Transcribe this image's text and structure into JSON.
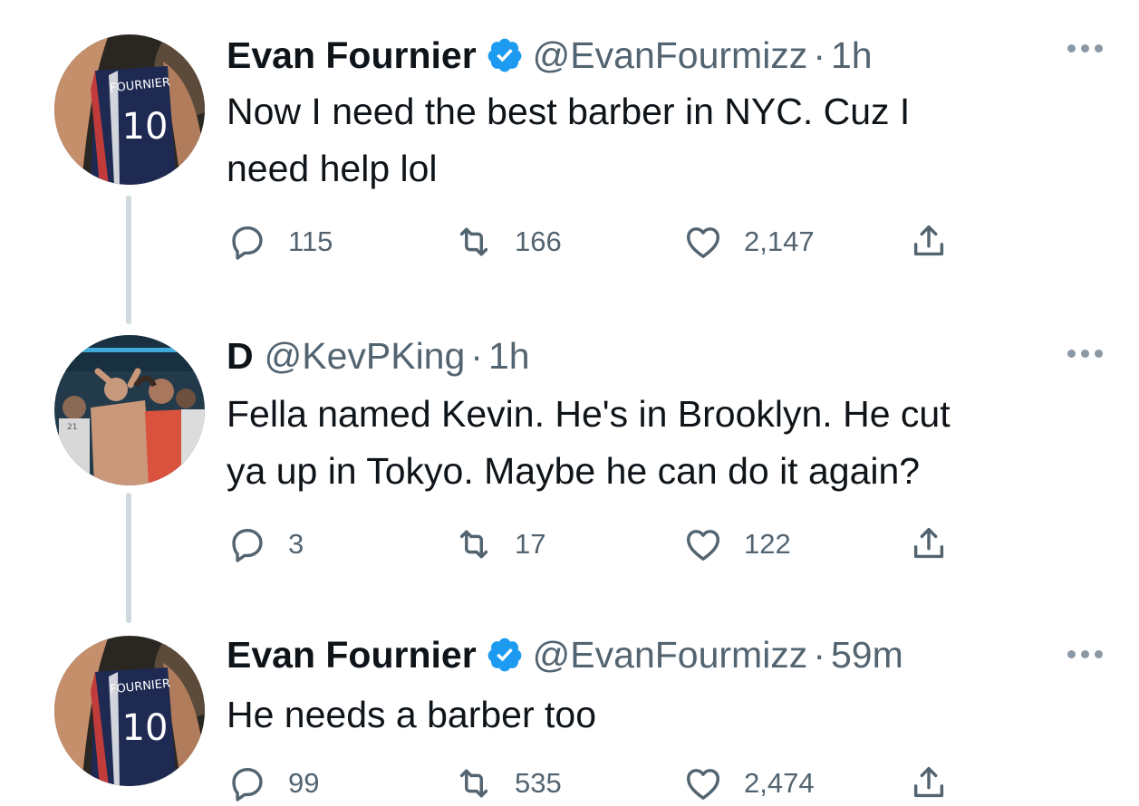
{
  "tweets": [
    {
      "name": "Evan Fournier",
      "verified": true,
      "handle": "@EvanFourmizz",
      "time": "1h",
      "text_lines": [
        "Now I need the best barber in NYC. Cuz I",
        "need help lol"
      ],
      "counts": {
        "reply": "115",
        "retweet": "166",
        "like": "2,147"
      }
    },
    {
      "name": "D",
      "verified": false,
      "handle": "@KevPKing",
      "time": "1h",
      "text_lines": [
        "Fella named Kevin. He's in Brooklyn.  He cut",
        "ya up in Tokyo.  Maybe he can do it again?"
      ],
      "counts": {
        "reply": "3",
        "retweet": "17",
        "like": "122"
      }
    },
    {
      "name": "Evan Fournier",
      "verified": true,
      "handle": "@EvanFourmizz",
      "time": "59m",
      "text_lines": [
        "He needs a barber too"
      ],
      "counts": {
        "reply": "99",
        "retweet": "535",
        "like": "2,474"
      }
    }
  ],
  "dot_separator": "·",
  "jersey": {
    "name": "FOURNIER",
    "number": "10"
  },
  "photo_jersey_number": "21",
  "colors": {
    "verified": "#1d9bf0",
    "secondary_text": "#536471",
    "thread_line": "#cfd9de"
  }
}
